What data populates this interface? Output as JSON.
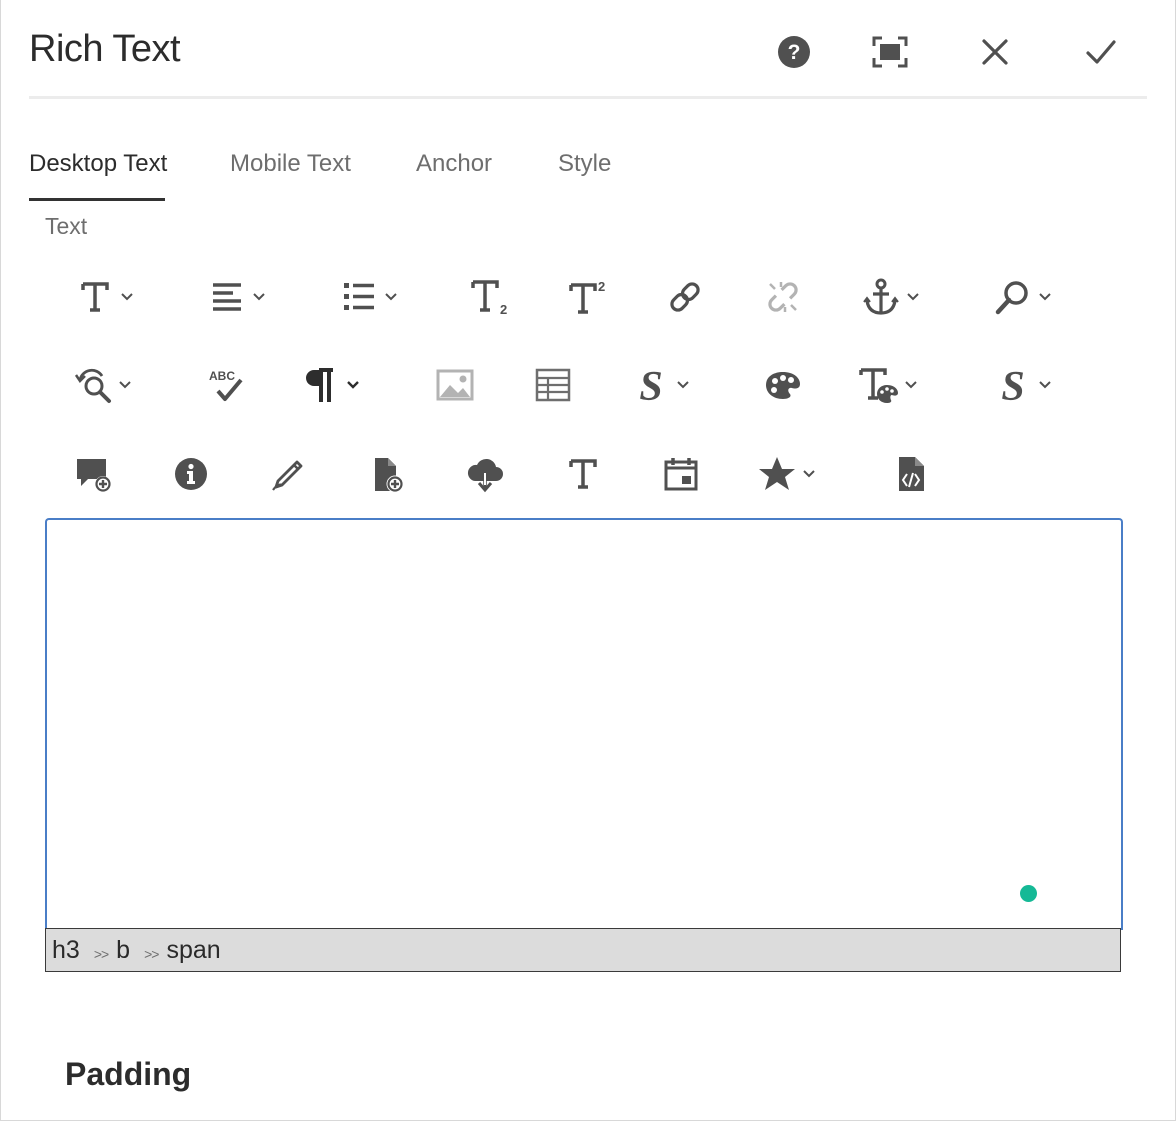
{
  "dialog": {
    "title": "Rich Text",
    "header_buttons": [
      {
        "name": "help-icon"
      },
      {
        "name": "fullscreen-icon"
      },
      {
        "name": "close-icon"
      },
      {
        "name": "checkmark-icon"
      }
    ]
  },
  "tabs": [
    {
      "label": "Desktop Text",
      "active": true
    },
    {
      "label": "Mobile Text",
      "active": false
    },
    {
      "label": "Anchor",
      "active": false
    },
    {
      "label": "Style",
      "active": false
    }
  ],
  "section_label": "Text",
  "toolbar": {
    "row1": [
      "text-format-icon",
      "align-left-icon",
      "bullet-list-icon",
      "subscript-icon",
      "superscript-icon",
      "link-icon",
      "unlink-icon",
      "anchor-icon",
      "search-icon"
    ],
    "row2": [
      "find-replace-icon",
      "spellcheck-icon",
      "paragraph-icon",
      "image-icon",
      "table-icon",
      "style-icon",
      "palette-icon",
      "text-style-icon",
      "special-style-icon"
    ],
    "row3": [
      "comment-add-icon",
      "info-icon",
      "edit-icon",
      "file-add-icon",
      "cloud-download-icon",
      "text-icon",
      "calendar-icon",
      "star-icon",
      "code-file-icon"
    ],
    "superscript_digit": "2",
    "subscript_digit": "2",
    "spellcheck_text": "ABC",
    "style_glyph": "S"
  },
  "editor": {
    "content": "",
    "path": [
      "h3",
      "b",
      "span"
    ],
    "path_separator": ">>",
    "accent_color": "#15b996",
    "focus_border_color": "#4a7ec7"
  },
  "padding_section": {
    "label": "Padding"
  }
}
